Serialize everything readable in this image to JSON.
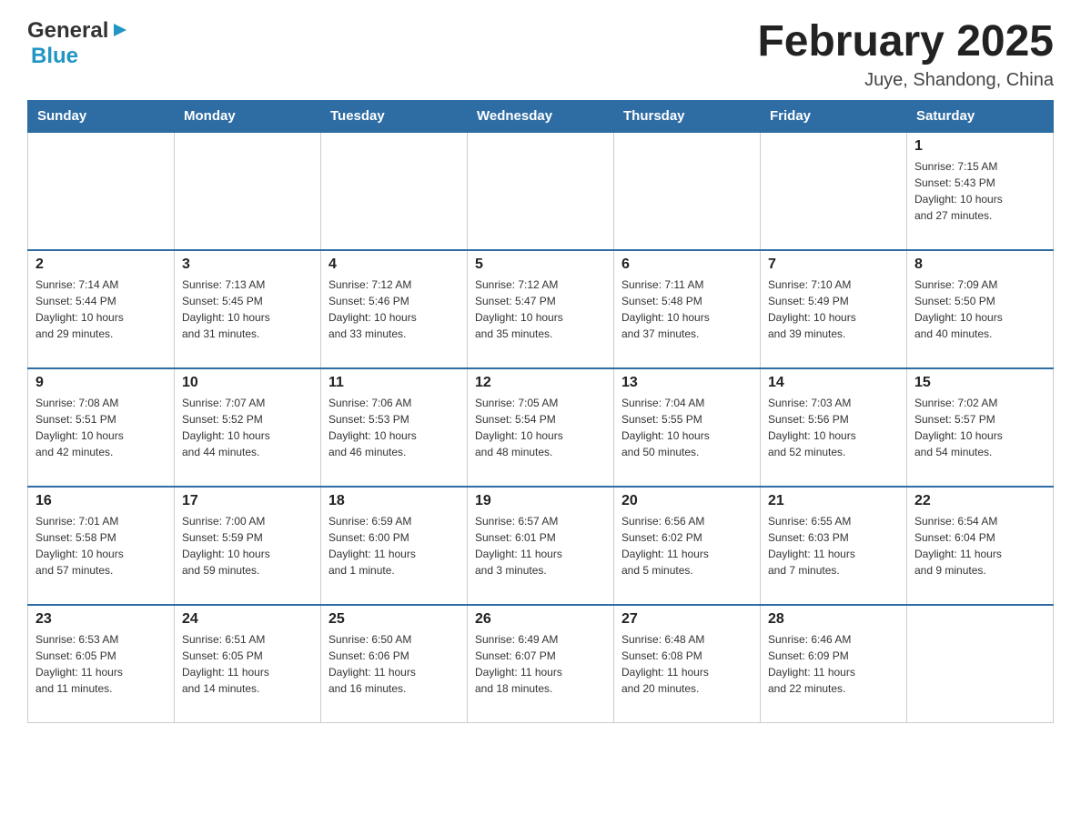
{
  "header": {
    "logo": {
      "general": "General",
      "blue": "Blue"
    },
    "title": "February 2025",
    "subtitle": "Juye, Shandong, China"
  },
  "days_of_week": [
    "Sunday",
    "Monday",
    "Tuesday",
    "Wednesday",
    "Thursday",
    "Friday",
    "Saturday"
  ],
  "weeks": [
    [
      {
        "day": "",
        "info": ""
      },
      {
        "day": "",
        "info": ""
      },
      {
        "day": "",
        "info": ""
      },
      {
        "day": "",
        "info": ""
      },
      {
        "day": "",
        "info": ""
      },
      {
        "day": "",
        "info": ""
      },
      {
        "day": "1",
        "info": "Sunrise: 7:15 AM\nSunset: 5:43 PM\nDaylight: 10 hours\nand 27 minutes."
      }
    ],
    [
      {
        "day": "2",
        "info": "Sunrise: 7:14 AM\nSunset: 5:44 PM\nDaylight: 10 hours\nand 29 minutes."
      },
      {
        "day": "3",
        "info": "Sunrise: 7:13 AM\nSunset: 5:45 PM\nDaylight: 10 hours\nand 31 minutes."
      },
      {
        "day": "4",
        "info": "Sunrise: 7:12 AM\nSunset: 5:46 PM\nDaylight: 10 hours\nand 33 minutes."
      },
      {
        "day": "5",
        "info": "Sunrise: 7:12 AM\nSunset: 5:47 PM\nDaylight: 10 hours\nand 35 minutes."
      },
      {
        "day": "6",
        "info": "Sunrise: 7:11 AM\nSunset: 5:48 PM\nDaylight: 10 hours\nand 37 minutes."
      },
      {
        "day": "7",
        "info": "Sunrise: 7:10 AM\nSunset: 5:49 PM\nDaylight: 10 hours\nand 39 minutes."
      },
      {
        "day": "8",
        "info": "Sunrise: 7:09 AM\nSunset: 5:50 PM\nDaylight: 10 hours\nand 40 minutes."
      }
    ],
    [
      {
        "day": "9",
        "info": "Sunrise: 7:08 AM\nSunset: 5:51 PM\nDaylight: 10 hours\nand 42 minutes."
      },
      {
        "day": "10",
        "info": "Sunrise: 7:07 AM\nSunset: 5:52 PM\nDaylight: 10 hours\nand 44 minutes."
      },
      {
        "day": "11",
        "info": "Sunrise: 7:06 AM\nSunset: 5:53 PM\nDaylight: 10 hours\nand 46 minutes."
      },
      {
        "day": "12",
        "info": "Sunrise: 7:05 AM\nSunset: 5:54 PM\nDaylight: 10 hours\nand 48 minutes."
      },
      {
        "day": "13",
        "info": "Sunrise: 7:04 AM\nSunset: 5:55 PM\nDaylight: 10 hours\nand 50 minutes."
      },
      {
        "day": "14",
        "info": "Sunrise: 7:03 AM\nSunset: 5:56 PM\nDaylight: 10 hours\nand 52 minutes."
      },
      {
        "day": "15",
        "info": "Sunrise: 7:02 AM\nSunset: 5:57 PM\nDaylight: 10 hours\nand 54 minutes."
      }
    ],
    [
      {
        "day": "16",
        "info": "Sunrise: 7:01 AM\nSunset: 5:58 PM\nDaylight: 10 hours\nand 57 minutes."
      },
      {
        "day": "17",
        "info": "Sunrise: 7:00 AM\nSunset: 5:59 PM\nDaylight: 10 hours\nand 59 minutes."
      },
      {
        "day": "18",
        "info": "Sunrise: 6:59 AM\nSunset: 6:00 PM\nDaylight: 11 hours\nand 1 minute."
      },
      {
        "day": "19",
        "info": "Sunrise: 6:57 AM\nSunset: 6:01 PM\nDaylight: 11 hours\nand 3 minutes."
      },
      {
        "day": "20",
        "info": "Sunrise: 6:56 AM\nSunset: 6:02 PM\nDaylight: 11 hours\nand 5 minutes."
      },
      {
        "day": "21",
        "info": "Sunrise: 6:55 AM\nSunset: 6:03 PM\nDaylight: 11 hours\nand 7 minutes."
      },
      {
        "day": "22",
        "info": "Sunrise: 6:54 AM\nSunset: 6:04 PM\nDaylight: 11 hours\nand 9 minutes."
      }
    ],
    [
      {
        "day": "23",
        "info": "Sunrise: 6:53 AM\nSunset: 6:05 PM\nDaylight: 11 hours\nand 11 minutes."
      },
      {
        "day": "24",
        "info": "Sunrise: 6:51 AM\nSunset: 6:05 PM\nDaylight: 11 hours\nand 14 minutes."
      },
      {
        "day": "25",
        "info": "Sunrise: 6:50 AM\nSunset: 6:06 PM\nDaylight: 11 hours\nand 16 minutes."
      },
      {
        "day": "26",
        "info": "Sunrise: 6:49 AM\nSunset: 6:07 PM\nDaylight: 11 hours\nand 18 minutes."
      },
      {
        "day": "27",
        "info": "Sunrise: 6:48 AM\nSunset: 6:08 PM\nDaylight: 11 hours\nand 20 minutes."
      },
      {
        "day": "28",
        "info": "Sunrise: 6:46 AM\nSunset: 6:09 PM\nDaylight: 11 hours\nand 22 minutes."
      },
      {
        "day": "",
        "info": ""
      }
    ]
  ]
}
